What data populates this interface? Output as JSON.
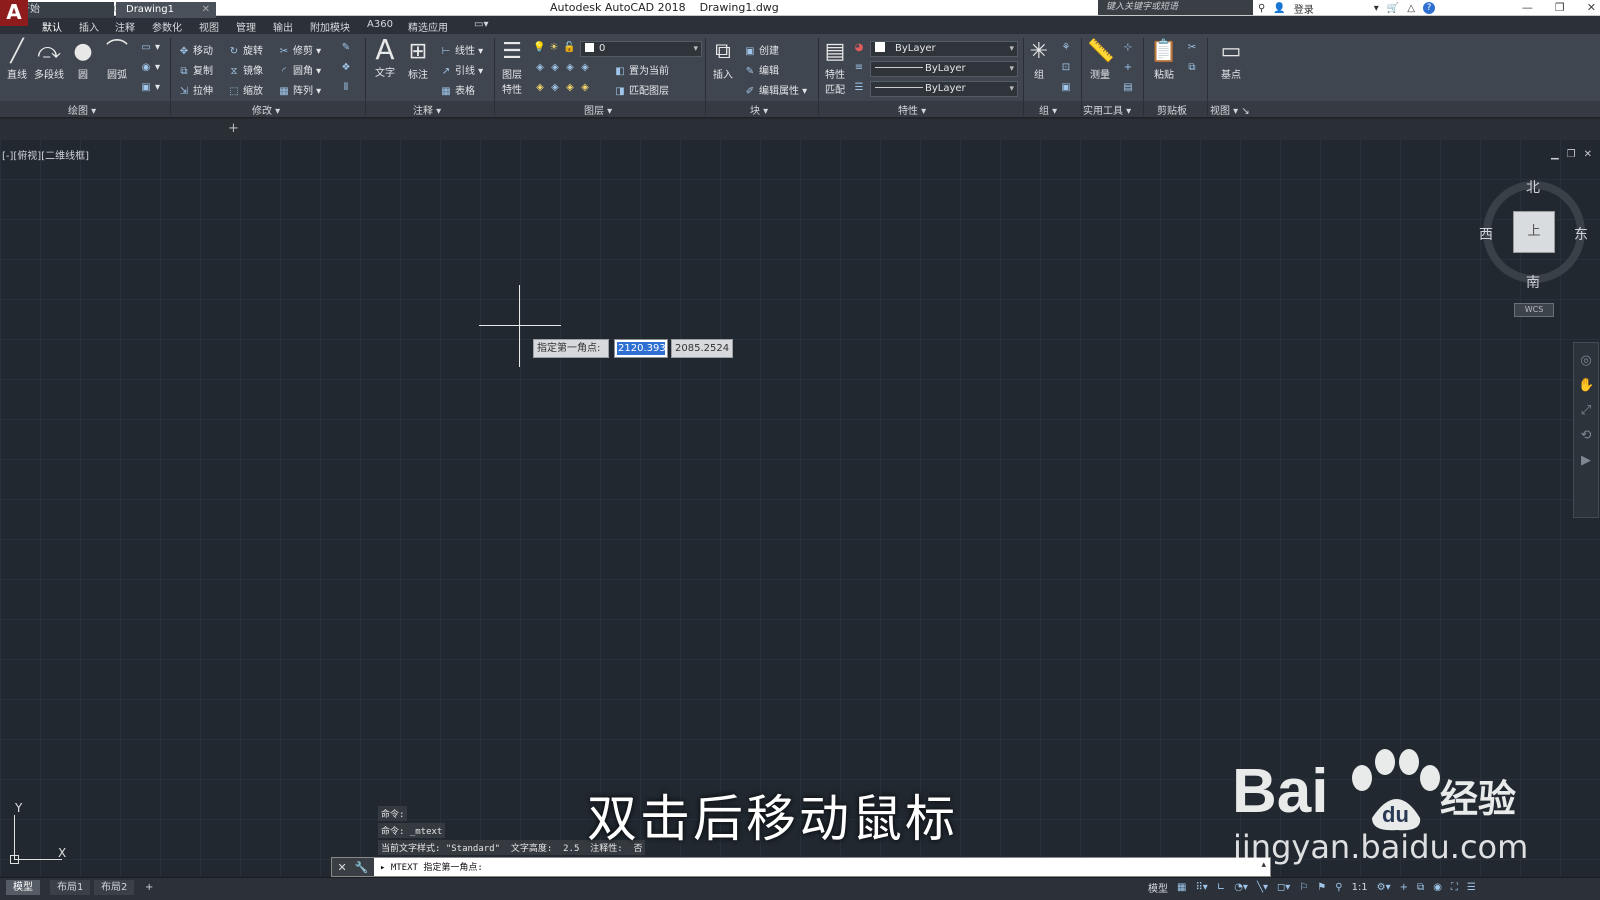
{
  "titlebar": {
    "app_name": "Autodesk AutoCAD 2018",
    "document": "Drawing1.dwg",
    "search_placeholder": "键入关键字或短语",
    "login_label": "登录",
    "logo_letter": "A"
  },
  "menu_tabs": [
    "默认",
    "插入",
    "注释",
    "参数化",
    "视图",
    "管理",
    "输出",
    "附加模块",
    "A360",
    "精选应用"
  ],
  "ribbon": {
    "draw": {
      "title": "绘图",
      "line": "直线",
      "polyline": "多段线",
      "circle": "圆",
      "arc": "圆弧"
    },
    "modify": {
      "title": "修改",
      "move": "移动",
      "rotate": "旋转",
      "trim": "修剪",
      "copy": "复制",
      "mirror": "镜像",
      "fillet": "圆角",
      "stretch": "拉伸",
      "scale": "缩放",
      "array": "阵列"
    },
    "annotation": {
      "title": "注释",
      "text": "文字",
      "dimension": "标注",
      "linear": "线性",
      "leader": "引线",
      "table": "表格"
    },
    "layers": {
      "title": "图层",
      "layer_props_1": "图层",
      "layer_props_2": "特性",
      "layer_value": "0",
      "set_current": "置为当前",
      "match_layer": "匹配图层"
    },
    "block": {
      "title": "块",
      "insert": "插入",
      "create": "创建",
      "edit": "编辑",
      "edit_attributes": "编辑属性"
    },
    "properties": {
      "title": "特性",
      "match_1": "特性",
      "match_2": "匹配",
      "color": "ByLayer",
      "linetype": "ByLayer",
      "lineweight": "ByLayer"
    },
    "groups": {
      "title": "组",
      "group": "组"
    },
    "utilities": {
      "title": "实用工具",
      "measure": "测量"
    },
    "clipboard": {
      "title": "剪贴板",
      "paste": "粘贴"
    },
    "view": {
      "title": "视图",
      "base": "基点"
    }
  },
  "file_tabs": {
    "start": "开始",
    "drawing": "Drawing1"
  },
  "viewport": {
    "label": "[-][俯视][二维线框]",
    "prompt": "指定第一角点:",
    "x_value": "2120.393",
    "y_value": "2085.2524"
  },
  "viewcube": {
    "north": "北",
    "south": "南",
    "east": "东",
    "west": "西",
    "top": "上",
    "wcs": "WCS"
  },
  "ucs": {
    "x": "X",
    "y": "Y"
  },
  "command_history": [
    "命令:",
    "命令: _mtext",
    "当前文字样式: \"Standard\"  文字高度:  2.5  注释性:  否"
  ],
  "command_line": "MTEXT 指定第一角点:",
  "subtitle": "双击后移动鼠标",
  "watermark": {
    "brand": "Bai",
    "brand_suffix": "经验",
    "url": "jingyan.baidu.com"
  },
  "layout_tabs": [
    "模型",
    "布局1",
    "布局2"
  ],
  "status": {
    "model": "模型",
    "scale": "1:1"
  },
  "colors": {
    "canvas": "#212830",
    "ribbon": "#40464f",
    "accent": "#2f6fd1",
    "logo": "#8f1c1c"
  }
}
